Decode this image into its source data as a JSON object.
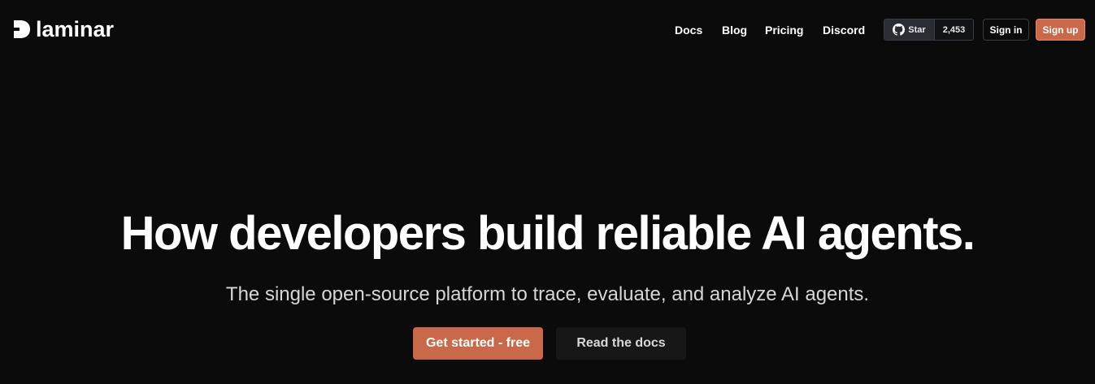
{
  "brand": {
    "name": "laminar",
    "logo_icon": "laminar-logo-icon"
  },
  "nav": {
    "links": [
      {
        "label": "Docs"
      },
      {
        "label": "Blog"
      },
      {
        "label": "Pricing"
      },
      {
        "label": "Discord"
      }
    ],
    "github": {
      "icon": "github-icon",
      "star_label": "Star",
      "count": "2,453"
    },
    "sign_in": "Sign in",
    "sign_up": "Sign up"
  },
  "hero": {
    "title": "How developers build reliable AI agents.",
    "subtitle": "The single open-source platform to trace, evaluate, and analyze AI agents.",
    "primary_cta": "Get started - free",
    "secondary_cta": "Read the docs"
  },
  "colors": {
    "background": "#0b0b0b",
    "accent": "#c9694a",
    "text": "#ffffff",
    "muted_text": "#d6d6d6",
    "secondary_button": "#171717"
  }
}
